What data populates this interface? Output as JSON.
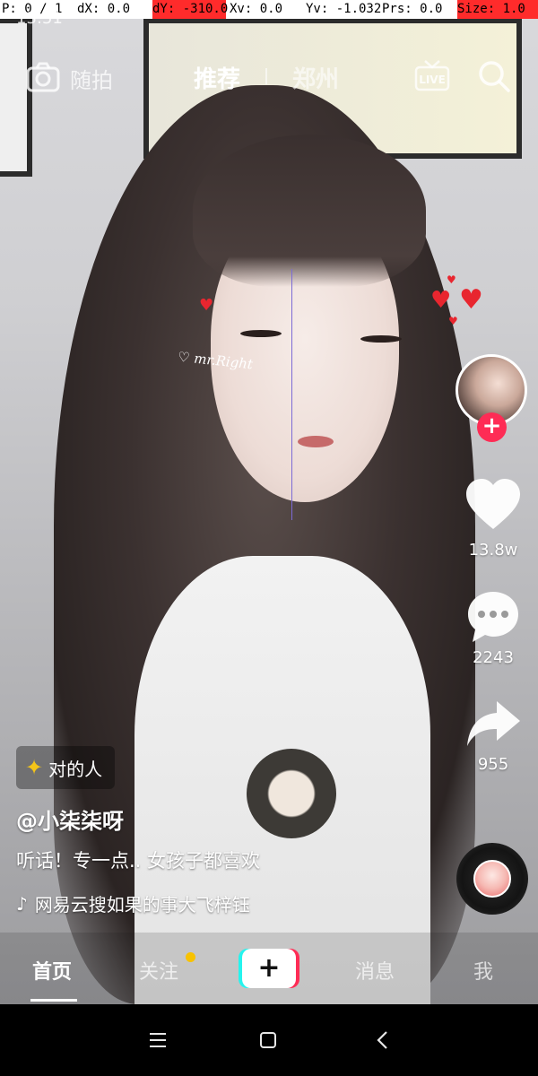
{
  "debug": {
    "pointer": "P: 0 / 1",
    "dx": "dX: 0.0",
    "dy": "dY: -310.0",
    "xv": "Xv: 0.0",
    "yv": "Yv: -1.032",
    "prs": "Prs: 0.0",
    "size": "Size: 1.0"
  },
  "status": {
    "time": "13:51"
  },
  "topbar": {
    "camera_label": "随拍",
    "tab_recommend": "推荐",
    "tab_city": "郑州",
    "live_label": "LIVE"
  },
  "video": {
    "sticker_text": "♡ mr.Right"
  },
  "rail": {
    "likes": "13.8w",
    "comments": "2243",
    "shares": "955"
  },
  "info": {
    "tag": "对的人",
    "username": "@小柒柒呀",
    "caption": "听话！专一点.. 女孩子都喜欢",
    "music": "网易云搜如果的事大飞梓钰"
  },
  "tabs": {
    "home": "首页",
    "follow": "关注",
    "create": "+",
    "messages": "消息",
    "me": "我"
  },
  "colors": {
    "accent": "#fe2c55",
    "cyan": "#25f4ee",
    "dot": "#f8c200"
  }
}
